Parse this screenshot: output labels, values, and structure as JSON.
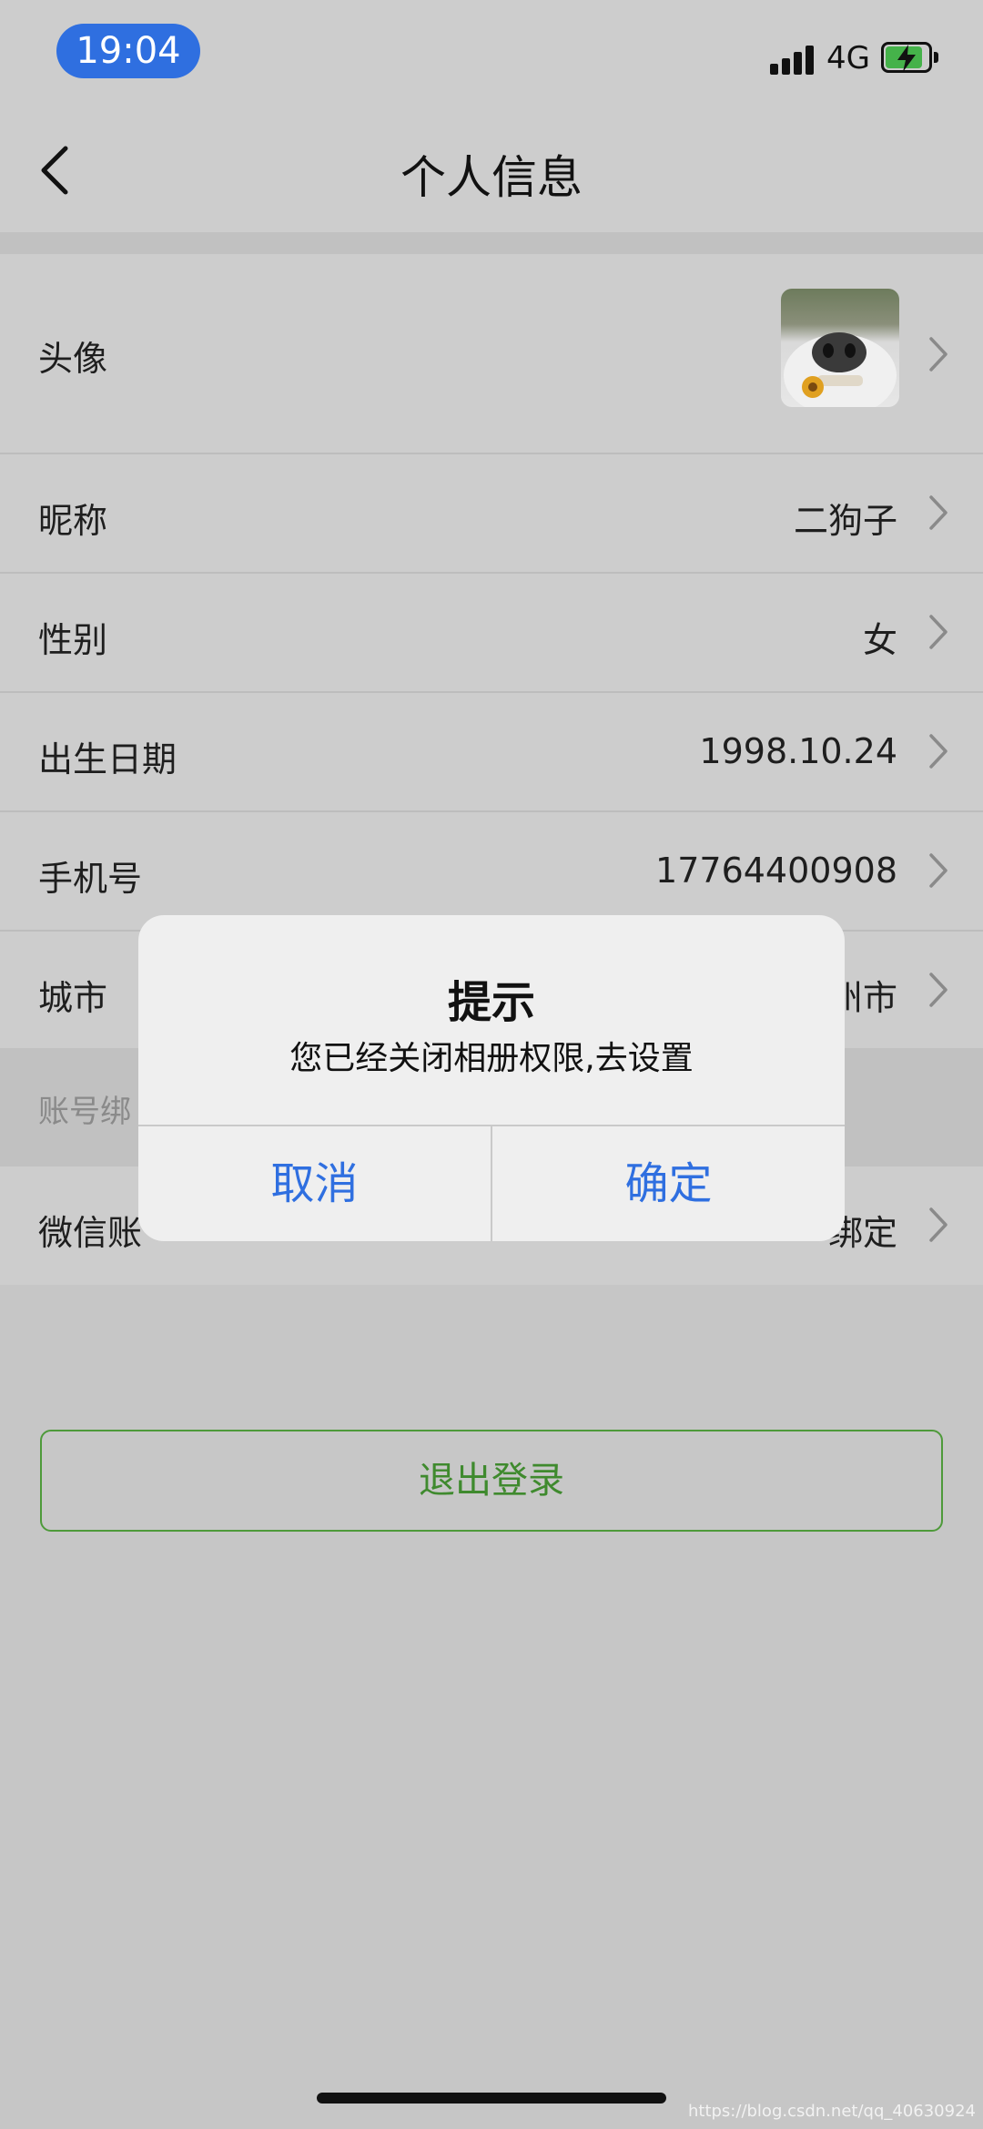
{
  "status_bar": {
    "time": "19:04",
    "network": "4G",
    "battery_color": "#45b24a",
    "time_bg": "#2f6fe0"
  },
  "nav": {
    "title": "个人信息",
    "back_icon": "chevron-left-icon"
  },
  "rows": [
    {
      "label": "头像",
      "value": ""
    },
    {
      "label": "昵称",
      "value": "二狗子"
    },
    {
      "label": "性别",
      "value": "女"
    },
    {
      "label": "出生日期",
      "value": "1998.10.24"
    },
    {
      "label": "手机号",
      "value": "17764400908"
    },
    {
      "label": "城市",
      "value": "州市"
    }
  ],
  "section": {
    "header": "账号绑"
  },
  "wechat_row": {
    "label": "微信账",
    "value": "绑定"
  },
  "logout": {
    "label": "退出登录",
    "color": "#3f8a2e"
  },
  "dialog": {
    "title": "提示",
    "message": "您已经关闭相册权限,去设置",
    "cancel": "取消",
    "confirm": "确定",
    "button_color": "#2f6fe0"
  },
  "watermark": "https://blog.csdn.net/qq_40630924"
}
